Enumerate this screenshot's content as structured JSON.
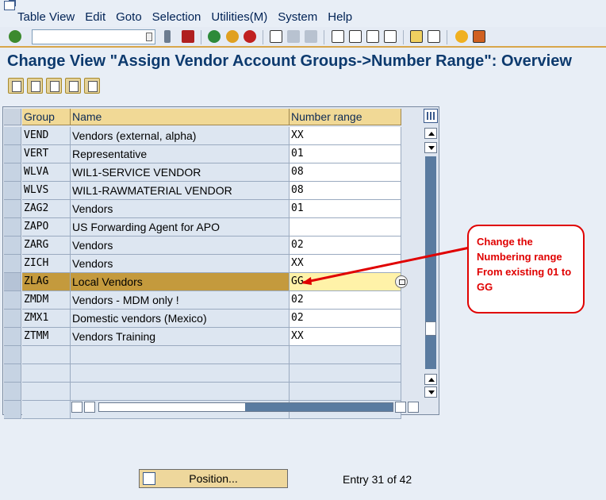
{
  "menu": [
    "Table View",
    "Edit",
    "Goto",
    "Selection",
    "Utilities(M)",
    "System",
    "Help"
  ],
  "toolbar": {
    "command_field_value": "",
    "icons": [
      "enter-icon",
      "back-icon",
      "save-icon",
      "back-green-icon",
      "exit-icon",
      "cancel-icon",
      "print-icon",
      "find-icon",
      "find-next-icon",
      "first-page-icon",
      "prev-page-icon",
      "next-page-icon",
      "last-page-icon",
      "create-session-icon",
      "shortcut-icon",
      "help-icon",
      "customize-icon"
    ]
  },
  "title": "Change View \"Assign Vendor Account Groups->Number Range\": Overview",
  "table": {
    "headers": {
      "group": "Group",
      "name": "Name",
      "range": "Number range"
    },
    "rows": [
      {
        "group": "VEND",
        "name": "Vendors (external, alpha)",
        "range": "XX"
      },
      {
        "group": "VERT",
        "name": "Representative",
        "range": "01"
      },
      {
        "group": "WLVA",
        "name": "WIL1-SERVICE VENDOR",
        "range": "08"
      },
      {
        "group": "WLVS",
        "name": "WIL1-RAWMATERIAL VENDOR",
        "range": "08"
      },
      {
        "group": "ZAG2",
        "name": "Vendors",
        "range": "01"
      },
      {
        "group": "ZAPO",
        "name": "US Forwarding Agent for APO",
        "range": ""
      },
      {
        "group": "ZARG",
        "name": "Vendors",
        "range": "02"
      },
      {
        "group": "ZICH",
        "name": "Vendors",
        "range": "XX"
      },
      {
        "group": "ZLAG",
        "name": "Local Vendors",
        "range": "GG"
      },
      {
        "group": "ZMDM",
        "name": "Vendors - MDM only !",
        "range": "02"
      },
      {
        "group": "ZMX1",
        "name": "Domestic vendors (Mexico)",
        "range": "02"
      },
      {
        "group": "ZTMM",
        "name": "Vendors Training",
        "range": "XX"
      }
    ],
    "selected_index": 8
  },
  "footer": {
    "position_label": "Position...",
    "entry_text": "Entry 31 of 42"
  },
  "annotation": {
    "lines": [
      "Change the",
      "Numbering range",
      "From existing 01 to",
      "GG"
    ],
    "color": "#e00000"
  }
}
